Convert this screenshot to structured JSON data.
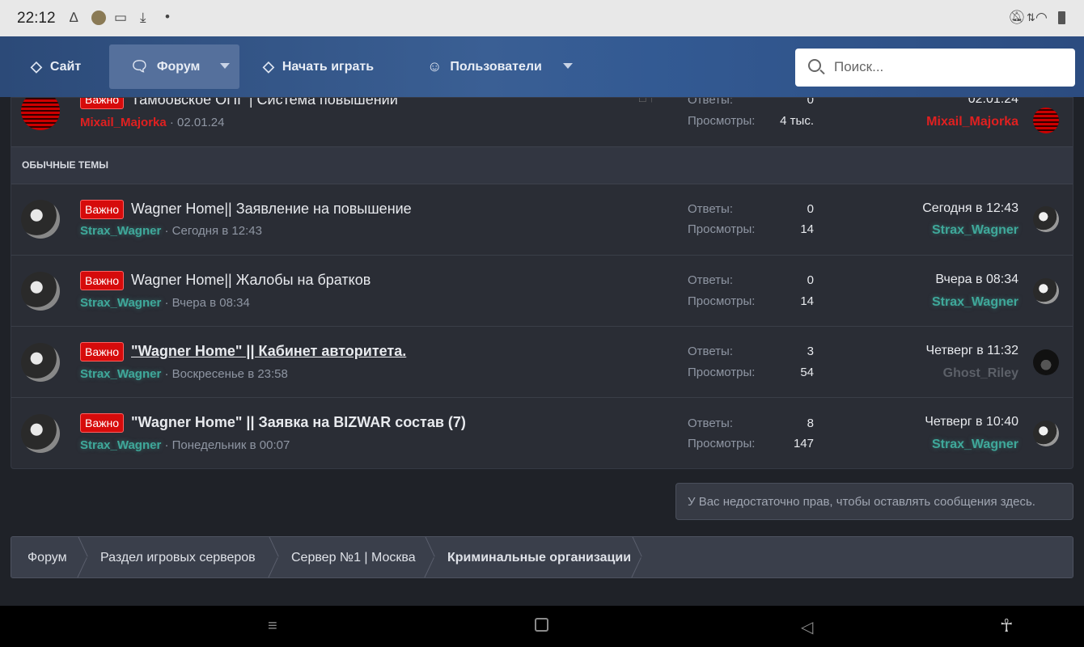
{
  "statusbar": {
    "time": "22:12",
    "left_icons": [
      "a-icon",
      "avatar-icon",
      "video-icon",
      "download-icon",
      "dot-icon"
    ],
    "right_icons": [
      "mute-icon",
      "data-arrows-icon",
      "wifi-icon",
      "battery-icon"
    ]
  },
  "nav": {
    "site": "Сайт",
    "forum": "Форум",
    "play": "Начать играть",
    "users": "Пользователи",
    "search_placeholder": "Поиск..."
  },
  "pinned_row": {
    "badge": "Важно",
    "title": "Тамбовское ОПГ | Система повышений",
    "author": "Mixail_Majorka",
    "meta": " · 02.01.24",
    "replies_label": "Ответы:",
    "replies": "0",
    "views_label": "Просмотры:",
    "views": "4 тыс.",
    "last_date": "02.01.24",
    "last_user": "Mixail_Majorka"
  },
  "section_title": "ОБЫЧНЫЕ ТЕМЫ",
  "threads": [
    {
      "badge": "Важно",
      "title": "Wagner Home|| Заявление на повышение",
      "author": "Strax_Wagner",
      "meta": " · Сегодня в 12:43",
      "replies_label": "Ответы:",
      "replies": "0",
      "views_label": "Просмотры:",
      "views": "14",
      "last_date": "Сегодня в 12:43",
      "last_user": "Strax_Wagner"
    },
    {
      "badge": "Важно",
      "title": "Wagner Home|| Жалобы на братков",
      "author": "Strax_Wagner",
      "meta": " · Вчера в 08:34",
      "replies_label": "Ответы:",
      "replies": "0",
      "views_label": "Просмотры:",
      "views": "14",
      "last_date": "Вчера в 08:34",
      "last_user": "Strax_Wagner"
    },
    {
      "badge": "Важно",
      "title": "\"Wagner Home\" || Кабинет авторитета.",
      "author": "Strax_Wagner",
      "meta": " · Воскресенье в 23:58",
      "replies_label": "Ответы:",
      "replies": "3",
      "views_label": "Просмотры:",
      "views": "54",
      "last_date": "Четверг в 11:32",
      "last_user": "Ghost_Riley"
    },
    {
      "badge": "Важно",
      "title": "\"Wagner Home\" || Заявка на BIZWAR состав (7)",
      "author": "Strax_Wagner",
      "meta": " · Понедельник в 00:07",
      "replies_label": "Ответы:",
      "replies": "8",
      "views_label": "Просмотры:",
      "views": "147",
      "last_date": "Четверг в 10:40",
      "last_user": "Strax_Wagner"
    }
  ],
  "notice": "У Вас недостаточно прав, чтобы оставлять сообщения здесь.",
  "breadcrumb": [
    "Форум",
    "Раздел игровых серверов",
    "Сервер №1 | Москва",
    "Криминальные организации"
  ],
  "colors": {
    "navbar": "#335a93",
    "badge": "#d60b0b",
    "user_teal": "#3fa89a",
    "user_red": "#e02020"
  }
}
